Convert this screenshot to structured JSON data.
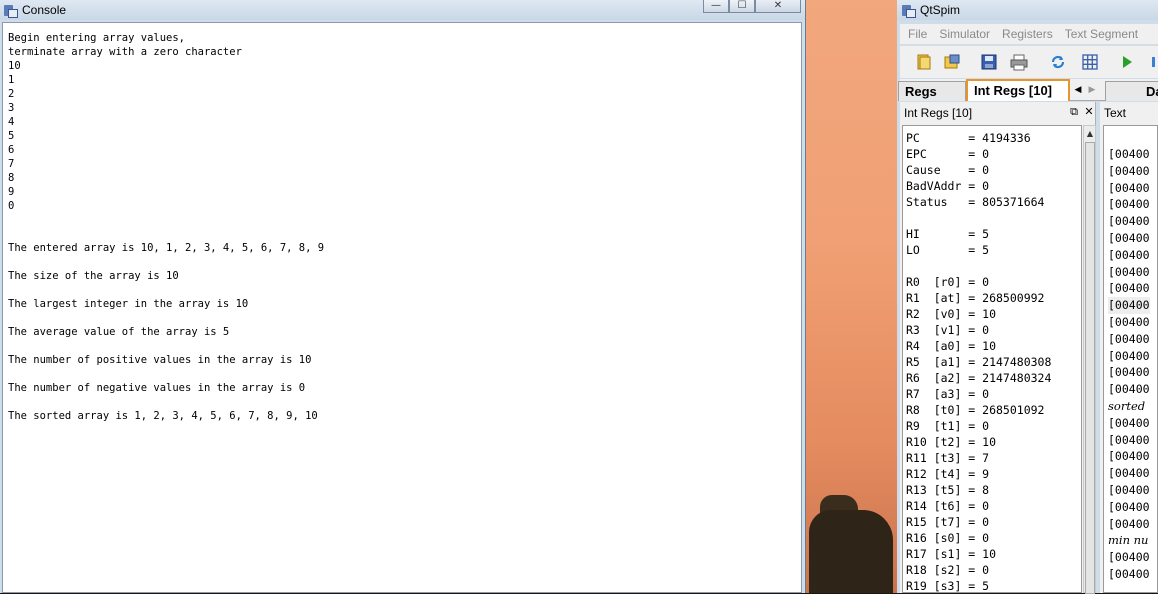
{
  "console": {
    "title": "Console",
    "buttons": {
      "minimize": "—",
      "maximize": "☐",
      "close": "✕"
    },
    "text": "Begin entering array values,\nterminate array with a zero character\n10\n1\n2\n3\n4\n5\n6\n7\n8\n9\n0\n\n\nThe entered array is 10, 1, 2, 3, 4, 5, 6, 7, 8, 9\n\nThe size of the array is 10\n\nThe largest integer in the array is 10\n\nThe average value of the array is 5\n\nThe number of positive values in the array is 10\n\nThe number of negative values in the array is 0\n\nThe sorted array is 1, 2, 3, 4, 5, 6, 7, 8, 9, 10"
  },
  "qtspim": {
    "title": "QtSpim",
    "menu": [
      "File",
      "Simulator",
      "Registers",
      "Text Segment"
    ],
    "tabs": [
      "Regs",
      "Int Regs [10]",
      "Da"
    ],
    "panel_title": "Int Regs [10]",
    "text_panel_title": "Text",
    "registers": "PC       = 4194336\nEPC      = 0\nCause    = 0\nBadVAddr = 0\nStatus   = 805371664\n\nHI       = 5\nLO       = 5\n\nR0  [r0] = 0\nR1  [at] = 268500992\nR2  [v0] = 10\nR3  [v1] = 0\nR4  [a0] = 10\nR5  [a1] = 2147480308\nR6  [a2] = 2147480324\nR7  [a3] = 0\nR8  [t0] = 268501092\nR9  [t1] = 0\nR10 [t2] = 10\nR11 [t3] = 7\nR12 [t4] = 9\nR13 [t5] = 8\nR14 [t6] = 0\nR15 [t7] = 0\nR16 [s0] = 0\nR17 [s1] = 10\nR18 [s2] = 0\nR19 [s3] = 5",
    "text_rows": [
      "[00400",
      "[00400",
      "[00400",
      "[00400",
      "[00400",
      "[00400",
      "[00400",
      "[00400",
      "[00400",
      "[00400",
      "[00400",
      "[00400",
      "[00400",
      "[00400",
      "[00400",
      "sorted",
      "[00400",
      "[00400",
      "[00400",
      "[00400",
      "[00400",
      "[00400",
      "[00400",
      "min nu",
      "[00400",
      "[00400"
    ]
  }
}
